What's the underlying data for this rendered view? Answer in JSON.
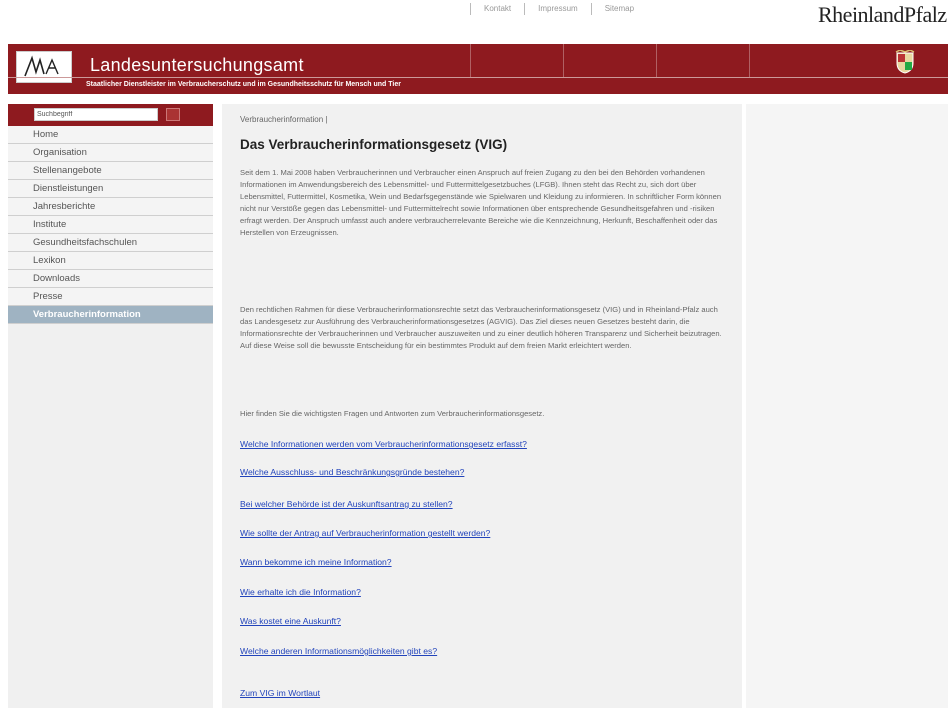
{
  "top_links": [
    "Kontakt",
    "Impressum",
    "Sitemap"
  ],
  "brand": "RheinlandPfalz",
  "header": {
    "title": "Landesuntersuchungsamt",
    "subtitle": "Staatlicher Dienstleister im Verbraucherschutz und im Gesundheitsschutz für Mensch und Tier"
  },
  "search": {
    "value": "Suchbegriff"
  },
  "nav": [
    "Home",
    "Organisation",
    "Stellenangebote",
    "Dienstleistungen",
    "Jahresberichte",
    "Institute",
    "Gesundheitsfachschulen",
    "Lexikon",
    "Downloads",
    "Presse",
    "Verbraucherinformation"
  ],
  "main": {
    "breadcrumb": "Verbraucherinformation |",
    "title": "Das Verbraucherinformationsgesetz (VIG)",
    "p1": "Seit dem 1. Mai 2008 haben Verbraucherinnen und Verbraucher einen Anspruch auf freien Zugang zu den bei den Behörden vorhandenen Informationen im Anwendungsbereich des Lebensmittel- und Futtermittelgesetzbuches (LFGB). Ihnen steht das Recht zu, sich dort über Lebensmittel, Futtermittel, Kosmetika, Wein und Bedarfsgegenstände wie Spielwaren und Kleidung zu informieren. In schriftlicher Form können nicht nur Verstöße gegen das Lebensmittel- und Futtermittelrecht sowie Informationen über entsprechende Gesundheitsgefahren und -risiken erfragt werden. Der Anspruch umfasst auch andere verbraucherrelevante Bereiche wie die Kennzeichnung, Herkunft, Beschaffenheit oder das Herstellen von Erzeugnissen.",
    "p2": "Den rechtlichen Rahmen für diese Verbraucherinformationsrechte setzt das Verbraucherinformationsgesetz (VIG) und in Rheinland-Pfalz auch das Landesgesetz zur Ausführung des Verbraucherinformationsgesetzes (AGVIG). Das Ziel dieses neuen Gesetzes besteht darin, die Informationsrechte der Verbraucherinnen und Verbraucher auszuweiten und zu einer deutlich höheren Transparenz und Sicherheit beizutragen. Auf diese Weise soll die bewusste Entscheidung für ein bestimmtes Produkt auf dem freien Markt erleichtert werden.",
    "p3": "Hier finden Sie die wichtigsten Fragen und Antworten zum Verbraucherinformationsgesetz.",
    "links": [
      "Welche Informationen werden vom Verbraucherinformationsgesetz erfasst?",
      "Welche Ausschluss- und Beschränkungsgründe bestehen?",
      "Bei welcher Behörde ist der Auskunftsantrag zu stellen?",
      "Wie sollte der Antrag auf Verbraucherinformation gestellt werden?",
      "Wann bekomme ich meine Information?",
      "Wie erhalte ich die Information?",
      "Was kostet eine Auskunft?",
      " Welche anderen Informationsmöglichkeiten gibt es?",
      "Zum VIG im Wortlaut"
    ]
  },
  "colors": {
    "header_red": "#8e1a1f",
    "active_nav": "#9fb3c2",
    "link_blue": "#2244bb"
  }
}
